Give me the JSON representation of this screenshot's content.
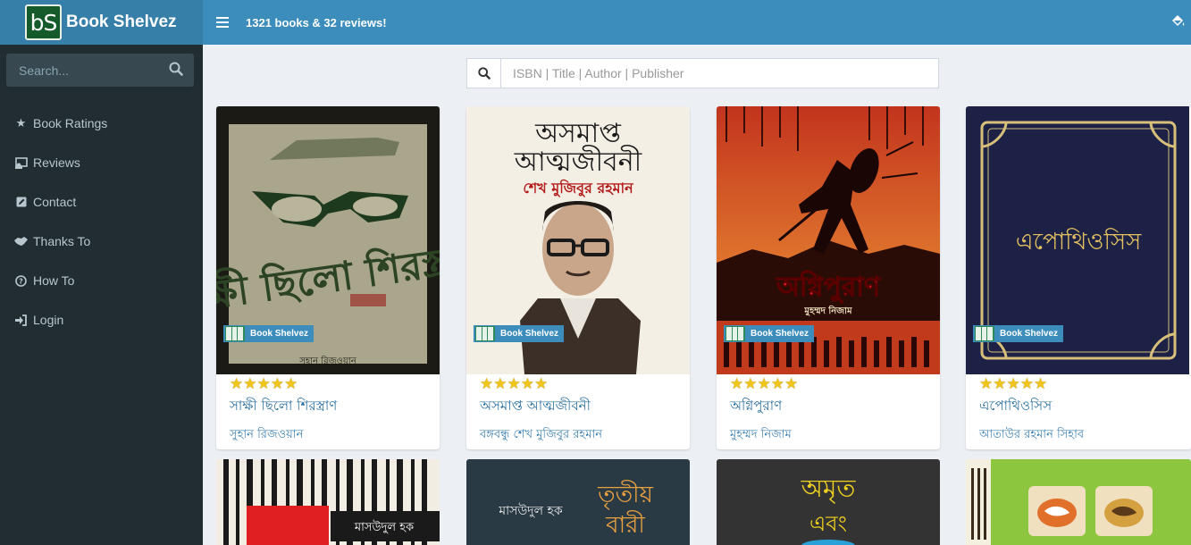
{
  "brand": {
    "logo_text": "bS",
    "name": "Book Shelvez"
  },
  "topbar": {
    "title": "1321 books & 32 reviews!",
    "icon": "paint-bucket-icon"
  },
  "sidebar": {
    "search_placeholder": "Search...",
    "items": [
      {
        "label": "Book Ratings",
        "icon": "star-half-icon"
      },
      {
        "label": "Reviews",
        "icon": "book-reader-icon"
      },
      {
        "label": "Contact",
        "icon": "edit-icon"
      },
      {
        "label": "Thanks To",
        "icon": "handshake-icon"
      },
      {
        "label": "How To",
        "icon": "question-circle-icon"
      },
      {
        "label": "Login",
        "icon": "sign-in-icon"
      }
    ]
  },
  "main": {
    "search_placeholder": "ISBN | Title | Author | Publisher"
  },
  "badge_label": "Book Shelvez",
  "books": [
    {
      "title": "সাক্ষী ছিলো শিরস্ত্রাণ",
      "author": "সুহান রিজওয়ান",
      "rating": 5,
      "cover_title": "সাক্ষী ছিলো শিরস্ত্রাণ",
      "cover_author": "সুহান রিজওয়ান"
    },
    {
      "title": "অসমাপ্ত আত্মজীবনী",
      "author": "বঙ্গবন্ধু শেখ মুজিবুর রহমান",
      "rating": 5,
      "cover_title_1": "অসমাপ্ত",
      "cover_title_2": "আত্মজীবনী",
      "cover_author": "শেখ মুজিবুর রহমান"
    },
    {
      "title": "অগ্নিপুরাণ",
      "author": "মুহম্মদ নিজাম",
      "rating": 5,
      "cover_title": "অগ্নিপুরাণ",
      "cover_author": "মুহম্মদ নিজাম"
    },
    {
      "title": "এপোথিওসিস",
      "author": "আতাউর রহমান সিহাব",
      "rating": 5,
      "cover_title": "এপোথিওসিস"
    }
  ],
  "second_row": [
    {
      "cover_text": "মাসউদুল হক"
    },
    {
      "cover_text_1": "মাসউদুল হক",
      "cover_text_2": "তৃতীয়",
      "cover_text_3": "বারী"
    },
    {
      "cover_text_1": "অমৃত",
      "cover_text_2": "এবং"
    },
    {
      "cover_text": ""
    }
  ]
}
